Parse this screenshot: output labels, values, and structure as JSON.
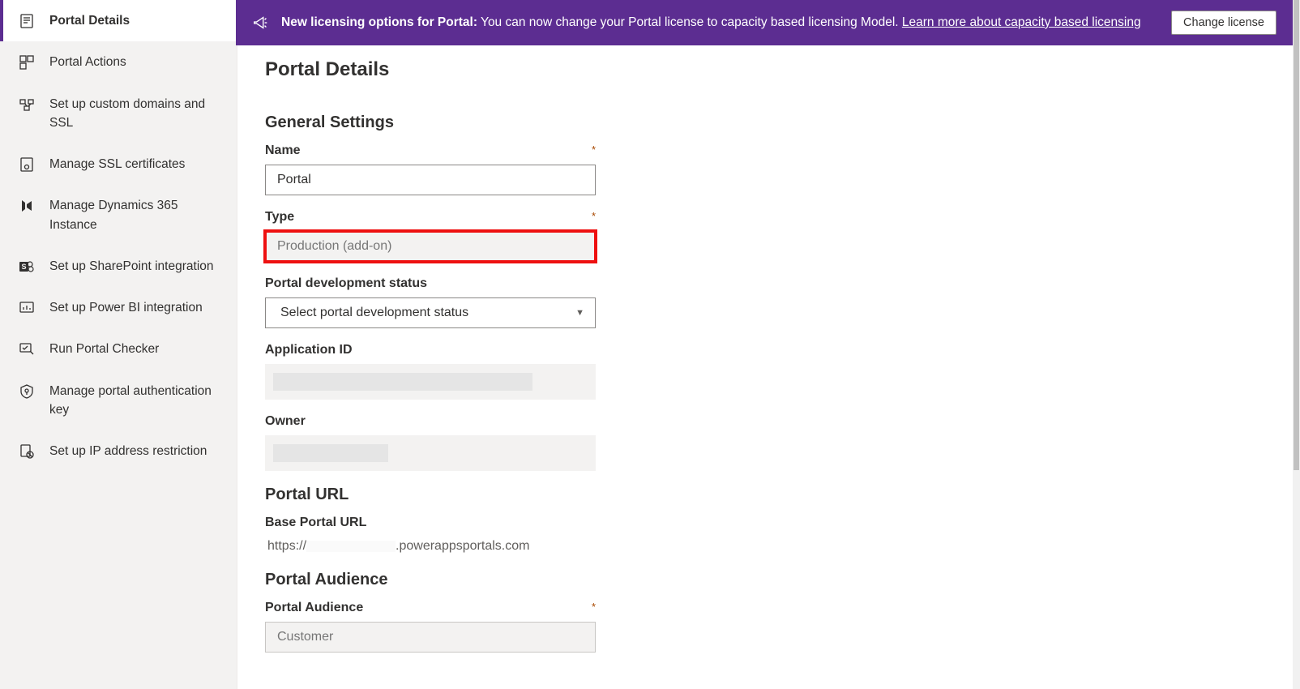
{
  "banner": {
    "bold_text": "New licensing options for Portal:",
    "text": " You can now change your Portal license to capacity based licensing Model. ",
    "link_text": "Learn more about capacity based licensing",
    "button": "Change license"
  },
  "sidebar": {
    "items": [
      {
        "label": "Portal Details",
        "active": true
      },
      {
        "label": "Portal Actions",
        "active": false
      },
      {
        "label": "Set up custom domains and SSL",
        "active": false
      },
      {
        "label": "Manage SSL certificates",
        "active": false
      },
      {
        "label": "Manage Dynamics 365 Instance",
        "active": false
      },
      {
        "label": "Set up SharePoint integration",
        "active": false
      },
      {
        "label": "Set up Power BI integration",
        "active": false
      },
      {
        "label": "Run Portal Checker",
        "active": false
      },
      {
        "label": "Manage portal authentication key",
        "active": false
      },
      {
        "label": "Set up IP address restriction",
        "active": false
      }
    ]
  },
  "main": {
    "title": "Portal Details",
    "sections": {
      "general": {
        "title": "General Settings",
        "name_label": "Name",
        "name_value": "Portal",
        "type_label": "Type",
        "type_value": "Production (add-on)",
        "dev_status_label": "Portal development status",
        "dev_status_placeholder": "Select portal development status",
        "app_id_label": "Application ID",
        "owner_label": "Owner"
      },
      "url": {
        "title": "Portal URL",
        "base_label": "Base Portal URL",
        "base_prefix": "https://",
        "base_suffix": ".powerappsportals.com"
      },
      "audience": {
        "title": "Portal Audience",
        "label": "Portal Audience",
        "value": "Customer"
      }
    }
  }
}
